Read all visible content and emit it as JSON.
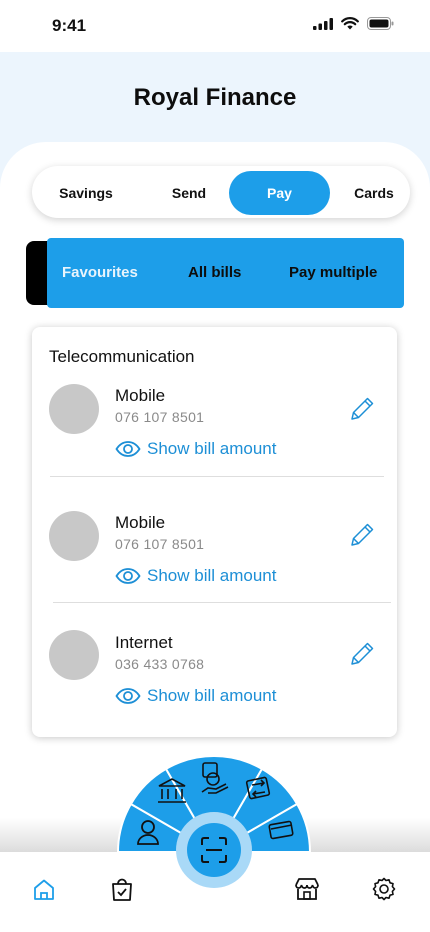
{
  "status": {
    "time": "9:41"
  },
  "header": {
    "title": "Royal Finance"
  },
  "segments": [
    {
      "label": "Savings",
      "active": false
    },
    {
      "label": "Send",
      "active": false
    },
    {
      "label": "Pay",
      "active": true
    },
    {
      "label": "Cards",
      "active": false
    }
  ],
  "bill_tabs": [
    {
      "label": "Favourites",
      "active": true
    },
    {
      "label": "All bills",
      "active": false
    },
    {
      "label": "Pay multiple",
      "active": false
    }
  ],
  "card": {
    "category": "Telecommunication",
    "bills": [
      {
        "name": "Mobile",
        "number": "076 107 8501",
        "action": "Show bill amount"
      },
      {
        "name": "Mobile",
        "number": "076 107 8501",
        "action": "Show bill amount"
      },
      {
        "name": "Internet",
        "number": "036 433 0768",
        "action": "Show bill amount"
      }
    ]
  },
  "quick_actions": [
    "bank-icon",
    "money-hand-icon",
    "transfer-icon",
    "cards-icon",
    "user-icon",
    "scan-icon"
  ],
  "bottom_nav": [
    "home-icon",
    "shopping-bag-icon",
    "store-icon",
    "settings-icon"
  ],
  "colors": {
    "accent": "#1d9ee9",
    "header_bg": "#ecf5fd",
    "avatar": "#c8c8c8",
    "link": "#1d8fd6"
  }
}
